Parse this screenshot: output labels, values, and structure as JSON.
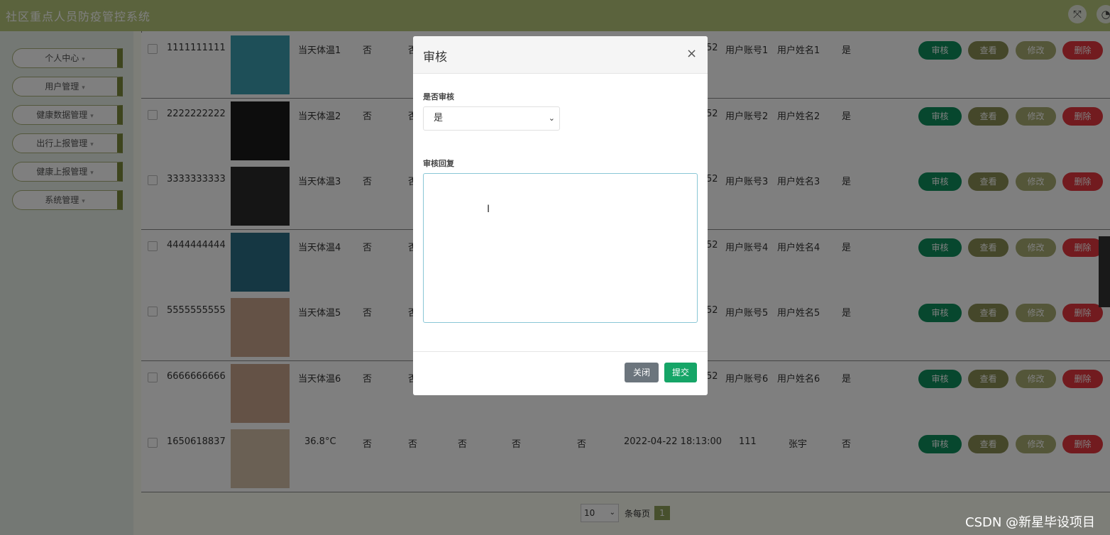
{
  "app": {
    "title": "社区重点人员防疫管控系统"
  },
  "sidebar": {
    "items": [
      {
        "label": "个人中心"
      },
      {
        "label": "用户管理"
      },
      {
        "label": "健康数据管理"
      },
      {
        "label": "出行上报管理"
      },
      {
        "label": "健康上报管理"
      },
      {
        "label": "系统管理"
      }
    ]
  },
  "table": {
    "rows": [
      {
        "id": "1111111111",
        "temp": "当天体温1",
        "c1": "否",
        "c2": "否",
        "c3": "",
        "c4": "",
        "c5": "",
        "time": "52",
        "account": "用户账号1",
        "name": "用户姓名1",
        "audited": "是"
      },
      {
        "id": "2222222222",
        "temp": "当天体温2",
        "c1": "否",
        "c2": "否",
        "c3": "",
        "c4": "",
        "c5": "",
        "time": "52",
        "account": "用户账号2",
        "name": "用户姓名2",
        "audited": "是"
      },
      {
        "id": "3333333333",
        "temp": "当天体温3",
        "c1": "否",
        "c2": "否",
        "c3": "",
        "c4": "",
        "c5": "",
        "time": "52",
        "account": "用户账号3",
        "name": "用户姓名3",
        "audited": "是"
      },
      {
        "id": "4444444444",
        "temp": "当天体温4",
        "c1": "否",
        "c2": "否",
        "c3": "",
        "c4": "",
        "c5": "",
        "time": "52",
        "account": "用户账号4",
        "name": "用户姓名4",
        "audited": "是"
      },
      {
        "id": "5555555555",
        "temp": "当天体温5",
        "c1": "否",
        "c2": "否",
        "c3": "",
        "c4": "",
        "c5": "",
        "time": "52",
        "account": "用户账号5",
        "name": "用户姓名5",
        "audited": "是"
      },
      {
        "id": "6666666666",
        "temp": "当天体温6",
        "c1": "否",
        "c2": "否",
        "c3": "",
        "c4": "",
        "c5": "",
        "time": "52",
        "account": "用户账号6",
        "name": "用户姓名6",
        "audited": "是"
      },
      {
        "id": "1650618837",
        "temp": "36.8°C",
        "c1": "否",
        "c2": "否",
        "c3": "否",
        "c4": "否",
        "c5": "否",
        "time": "2022-04-22 18:13:00",
        "account": "111",
        "name": "张宇",
        "audited": "否"
      }
    ],
    "actions": {
      "audit": "审核",
      "view": "查看",
      "edit": "修改",
      "delete": "删除"
    },
    "thumb_colors": [
      "#3c9fb0",
      "#1a1a1a",
      "#2b2b2b",
      "#2a6f86",
      "#c9a48c",
      "#c9a48c",
      "#d5c0a8"
    ]
  },
  "pager": {
    "page_size": "10",
    "per_page_label": "条每页",
    "page": "1"
  },
  "modal": {
    "title": "审核",
    "audit_label": "是否审核",
    "audit_value": "是",
    "reply_label": "审核回复",
    "reply_value": "",
    "close_label": "关闭",
    "submit_label": "提交"
  },
  "watermark": "CSDN @新星毕设项目"
}
